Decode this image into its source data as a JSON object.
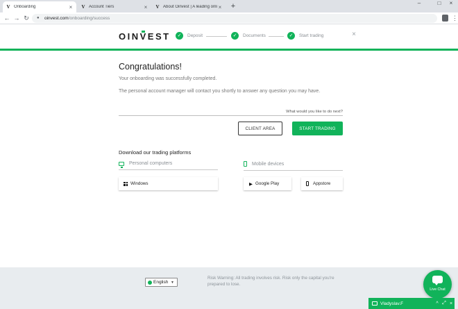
{
  "browser": {
    "tabs": [
      {
        "favicon": "V",
        "title": "Onboarding",
        "active": true
      },
      {
        "favicon": "V",
        "title": "Account Tiers",
        "active": false
      },
      {
        "favicon": "V",
        "title": "About Oinvest | A leading online",
        "active": false
      }
    ],
    "new_tab": "+",
    "window_controls": [
      "–",
      "□",
      "×"
    ],
    "address": {
      "host": "oinvest.com",
      "path": "/onboarding/success"
    }
  },
  "header": {
    "logo": {
      "pre": "OIN",
      "v": "V",
      "post": "EST"
    },
    "steps": [
      {
        "label": "Deposit",
        "status": "done"
      },
      {
        "label": "Documents",
        "status": "done"
      },
      {
        "label": "Start trading",
        "status": "done"
      }
    ],
    "close": "×",
    "accent_color": "#11b35a"
  },
  "main": {
    "title": "Congratulations!",
    "line1": "Your onboarding was successfully completed.",
    "line2": "The personal account manager will contact you shortly to answer any question you may have.",
    "next_placeholder": "What would you like to do next?",
    "client_area_btn": "CLIENT AREA",
    "start_trading_btn": "START TRADING",
    "platforms_title": "Download our trading platforms",
    "pc_heading": "Personal computers",
    "mobile_heading": "Mobile devices",
    "windows_btn": "Windows",
    "google_play_btn": "Google Play",
    "appstore_btn": "Appstore"
  },
  "footer": {
    "language": "English",
    "risk_warning": "Risk Warning: All trading involves risk. Risk only the capital you're prepared to lose."
  },
  "chat": {
    "bubble_label": "Live Chat",
    "agent_name": "Vladyslav.F",
    "controls": [
      "^",
      "⤢",
      "×"
    ]
  }
}
